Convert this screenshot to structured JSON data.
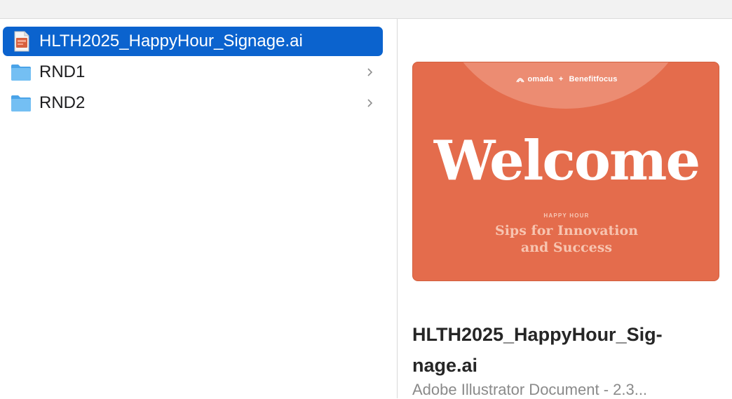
{
  "browser": {
    "items": [
      {
        "name": "HLTH2025_HappyHour_Signage.ai",
        "type": "file",
        "icon": "illustrator-file-icon",
        "selected": true
      },
      {
        "name": "RND1",
        "type": "folder",
        "icon": "folder-icon",
        "selected": false
      },
      {
        "name": "RND2",
        "type": "folder",
        "icon": "folder-icon",
        "selected": false
      }
    ]
  },
  "preview": {
    "thumbnail": {
      "brand_left": "omada",
      "brand_sep": "+",
      "brand_right": "Benefitfocus",
      "headline": "Welcome",
      "eyebrow": "HAPPY HOUR",
      "tagline_line1": "Sips for Innovation",
      "tagline_line2": "and Success",
      "background_color": "#e46c4c"
    },
    "filename_line1": "HLTH2025_HappyHour_Sig-",
    "filename_line2": "nage.ai",
    "kind": "Adobe Illustrator Document - 2.3..."
  },
  "colors": {
    "selection": "#0b63ce",
    "folder": "#5ab0ee"
  }
}
